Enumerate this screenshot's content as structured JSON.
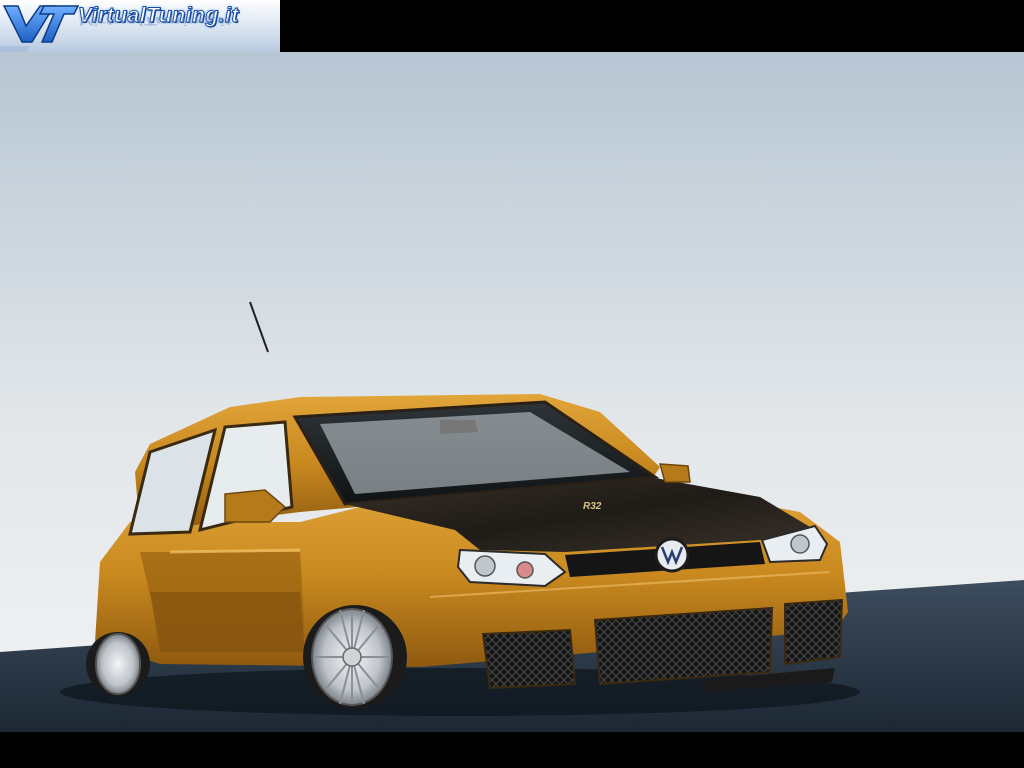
{
  "logo": {
    "site_name": "VirtualTuning.it",
    "mark": "VT"
  },
  "car": {
    "badge": "R32",
    "brand_emblem": "vw-emblem"
  },
  "colors": {
    "body_paint": "#c9891f",
    "hood_carbon": "#2c2620",
    "sky": "#dde3e8",
    "ground": "#2d3b4a",
    "letterbox": "#000000"
  }
}
